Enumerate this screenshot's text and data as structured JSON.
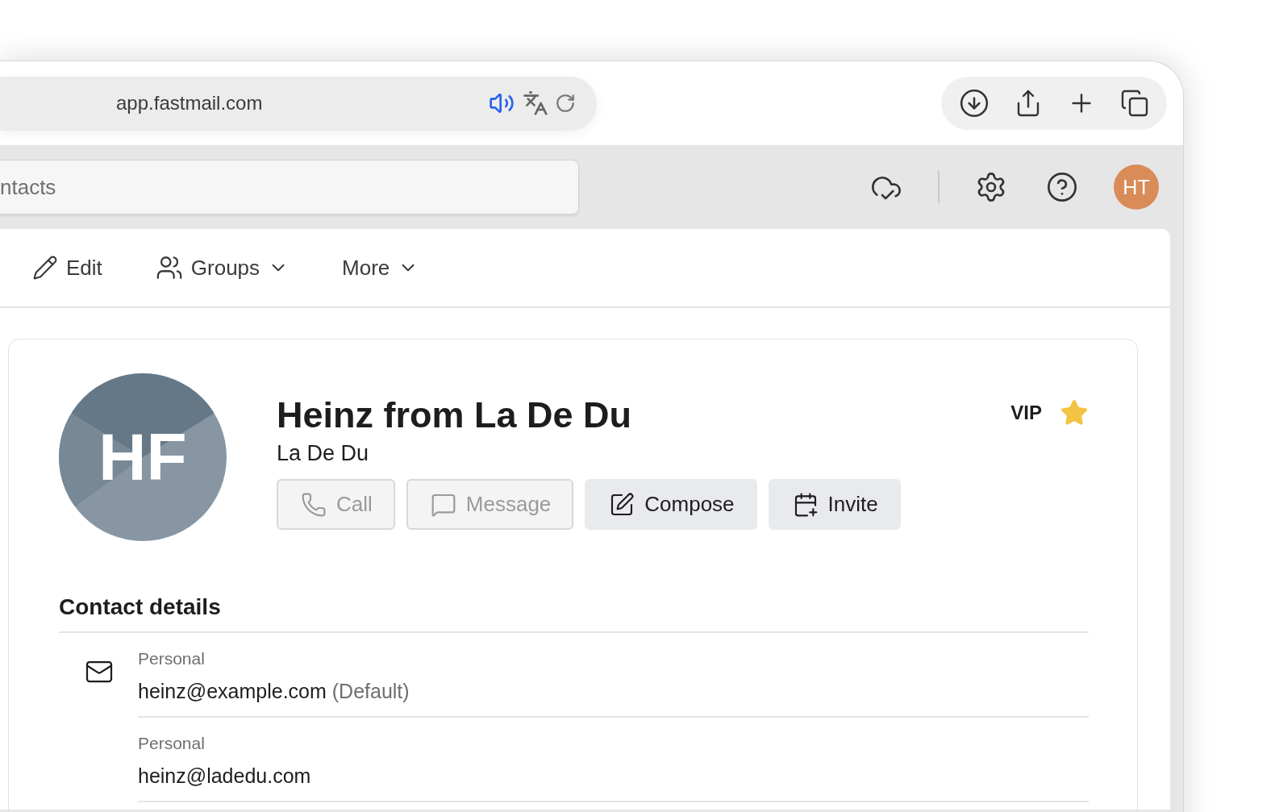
{
  "browser": {
    "url": "app.fastmail.com"
  },
  "app_header": {
    "search": {
      "placeholder": "ntacts"
    },
    "avatar": "HT"
  },
  "toolbar": [
    {
      "label": "Edit",
      "kind": "edit",
      "dropdown": false
    },
    {
      "label": "Groups",
      "kind": "groups",
      "dropdown": true
    },
    {
      "label": "More",
      "kind": "more",
      "dropdown": true
    }
  ],
  "contact": {
    "initials": "HF",
    "name": "Heinz from La De Du",
    "company": "La De Du",
    "vip": {
      "label": "VIP",
      "starred": true
    },
    "actions": [
      {
        "label": "Call",
        "kind": "call",
        "disabled": true
      },
      {
        "label": "Message",
        "kind": "message",
        "disabled": true
      },
      {
        "label": "Compose",
        "kind": "compose",
        "disabled": false
      },
      {
        "label": "Invite",
        "kind": "invite",
        "disabled": false
      }
    ],
    "details": {
      "heading": "Contact details",
      "emails": [
        {
          "label": "Personal",
          "address": "heinz@example.com",
          "note": "(Default)"
        },
        {
          "label": "Personal",
          "address": "heinz@ladedu.com"
        }
      ]
    }
  }
}
